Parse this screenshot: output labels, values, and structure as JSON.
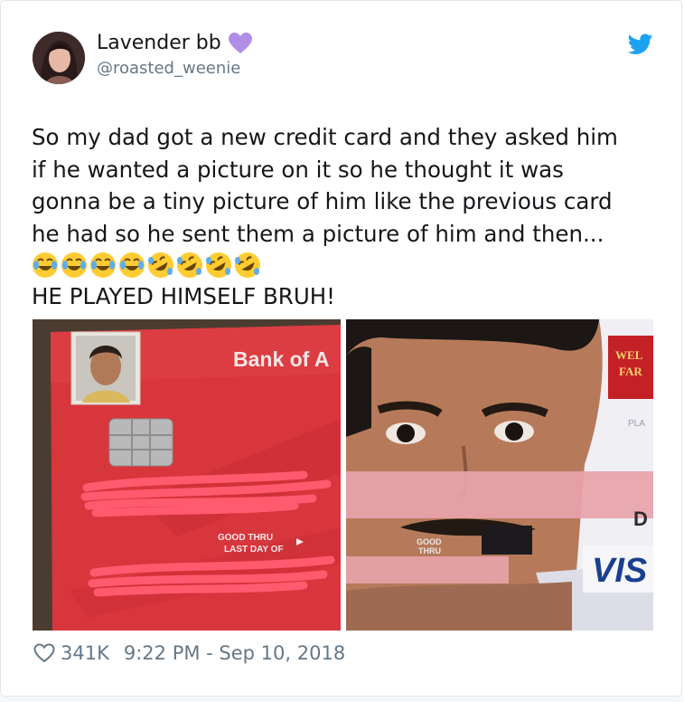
{
  "tweet": {
    "display_name": "Lavender bb",
    "handle": "@roasted_weenie",
    "text_lines": [
      "So my dad got a new credit card and they asked him",
      "if he wanted a picture on it so he thought it was",
      "gonna be a tiny picture of him like the previous card",
      "he had so he sent them a picture of him and then..."
    ],
    "emojis": [
      "joy",
      "joy",
      "joy",
      "joy",
      "rofl",
      "rofl",
      "rofl",
      "rofl"
    ],
    "last_line": "HE PLAYED HIMSELF BRUH!",
    "likes": "341K",
    "timestamp": "9:22 PM - Sep 10, 2018"
  },
  "images": {
    "left": {
      "bank_text": "Bank of A",
      "good_thru": "GOOD THRU",
      "last_day": "LAST DAY OF"
    },
    "right": {
      "brand_line1": "WEL",
      "brand_line2": "FAR",
      "plat": "PLA",
      "d_text": "D",
      "visa": "VIS",
      "good": "GOOD",
      "thru": "THRU"
    }
  },
  "colors": {
    "accent": "#1da1f2",
    "heart_emoji": "#b18ee6",
    "card_red": "#d8363d",
    "scribble": "#ff5a6e",
    "censor_pink": "#e8a3aa"
  }
}
